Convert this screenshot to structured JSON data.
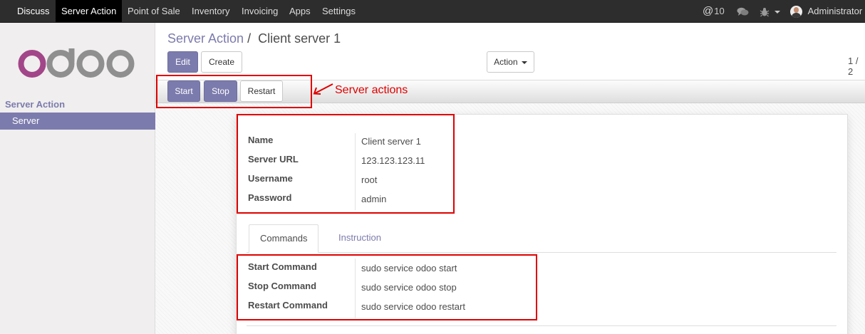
{
  "navbar": {
    "brand": "Discuss",
    "menu": [
      "Server Action",
      "Point of Sale",
      "Inventory",
      "Invoicing",
      "Apps",
      "Settings"
    ],
    "mentions_count": "10",
    "user": "Administrator ("
  },
  "sidebar": {
    "logo_text": "odoo",
    "section": "Server Action",
    "item": "Server"
  },
  "breadcrumb": {
    "parent": "Server Action",
    "separator": "/",
    "current": "Client server 1"
  },
  "buttons": {
    "edit": "Edit",
    "create": "Create",
    "action": "Action",
    "start": "Start",
    "stop": "Stop",
    "restart": "Restart"
  },
  "pager": "1 / 2",
  "annotation": "Server actions",
  "fields": {
    "name_label": "Name",
    "name_value": "Client server 1",
    "url_label": "Server URL",
    "url_value": "123.123.123.11",
    "username_label": "Username",
    "username_value": "root",
    "password_label": "Password",
    "password_value": "admin"
  },
  "tabs": [
    "Commands",
    "Instruction"
  ],
  "commands": {
    "start_label": "Start Command",
    "start_value": "sudo service odoo start",
    "stop_label": "Stop Command",
    "stop_value": "sudo service odoo stop",
    "restart_label": "Restart Command",
    "restart_value": "sudo service odoo restart"
  },
  "colors": {
    "brand": "#7c7bad",
    "navbar": "#2d2d2d",
    "annotation": "#e00000"
  },
  "icons": [
    "at-icon",
    "chat-icon",
    "bug-icon",
    "caret-down-icon",
    "avatar"
  ]
}
